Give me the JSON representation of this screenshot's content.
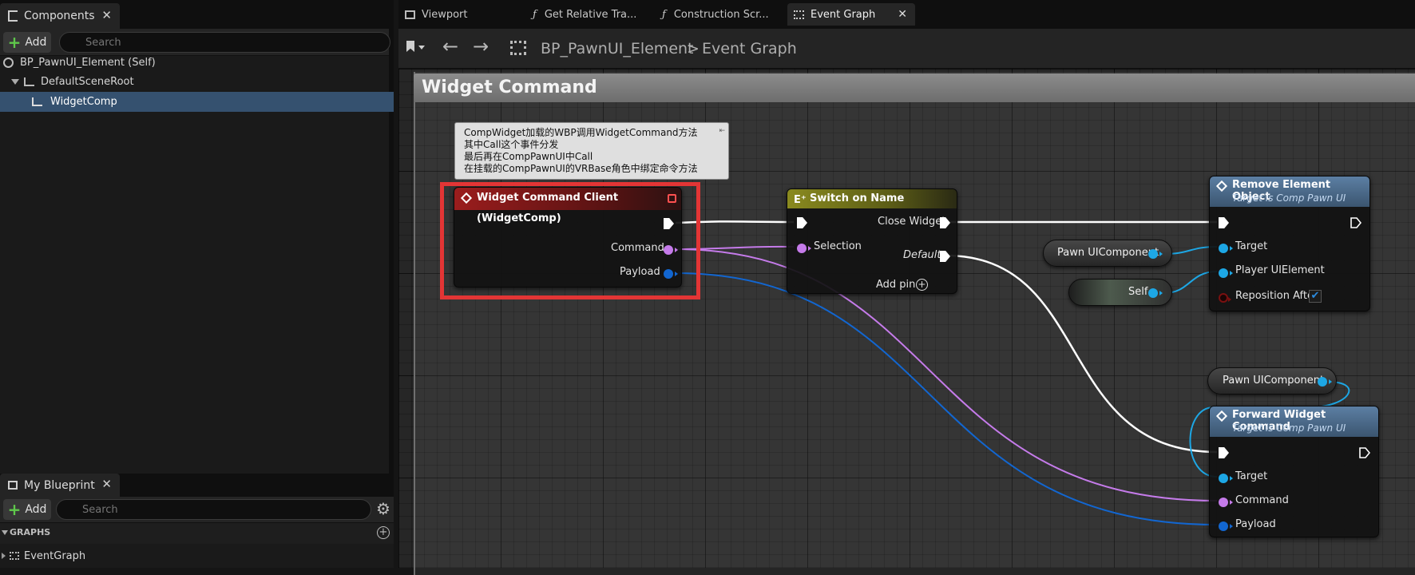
{
  "colors": {
    "exec": "#ffffff",
    "name_pin": "#c57bea",
    "object_pin": "#1da7e5",
    "struct_pin": "#1266d0",
    "event_header": "#8c1818",
    "switch_header": "#6c6d16",
    "function_header": "#4b6a8a",
    "highlight": "#e33535"
  },
  "components_panel": {
    "tab_label": "Components",
    "add_label": "Add",
    "search_placeholder": "Search",
    "tree": [
      {
        "label": "BP_PawnUI_Element (Self)"
      },
      {
        "label": "DefaultSceneRoot"
      },
      {
        "label": "WidgetComp"
      }
    ]
  },
  "my_blueprint_panel": {
    "tab_label": "My Blueprint",
    "add_label": "Add",
    "search_placeholder": "Search",
    "section_label": "GRAPHS",
    "items": [
      {
        "label": "EventGraph"
      }
    ]
  },
  "editor_tabs": [
    {
      "label": "Viewport",
      "icon": "viewport-icon"
    },
    {
      "label": "Get Relative Tra...",
      "icon": "function-icon"
    },
    {
      "label": "Construction Scr...",
      "icon": "function-icon"
    },
    {
      "label": "Event Graph",
      "icon": "graph-icon"
    }
  ],
  "breadcrumb": {
    "blueprint": "BP_PawnUI_Element",
    "separator": ">",
    "graph": "Event Graph"
  },
  "graph": {
    "comment_title": "Widget Command",
    "note_lines": [
      "CompWidget加载的WBP调用WidgetCommand方法",
      "其中Call这个事件分发",
      "最后再在CompPawnUI中Call",
      "在挂载的CompPawnUI的VRBase角色中绑定命令方法"
    ],
    "event_node": {
      "title": "Widget Command Client (WidgetComp)",
      "pins": {
        "command": "Command",
        "payload": "Payload"
      }
    },
    "switch_node": {
      "title": "Switch on Name",
      "selection": "Selection",
      "close_widget": "Close Widget",
      "default": "Default",
      "add_pin": "Add pin"
    },
    "remove_node": {
      "title": "Remove Element Object",
      "subtitle": "Target is Comp Pawn UI",
      "target": "Target",
      "player_ui_element": "Player UIElement",
      "reposition_after": "Reposition After",
      "reposition_checked": true
    },
    "forward_node": {
      "title": "Forward Widget Command",
      "subtitle": "Target is Comp Pawn UI",
      "target": "Target",
      "command": "Command",
      "payload": "Payload"
    },
    "variables": {
      "pawn_ui_component_1": "Pawn UIComponent",
      "self": "Self",
      "pawn_ui_component_2": "Pawn UIComponent"
    }
  }
}
